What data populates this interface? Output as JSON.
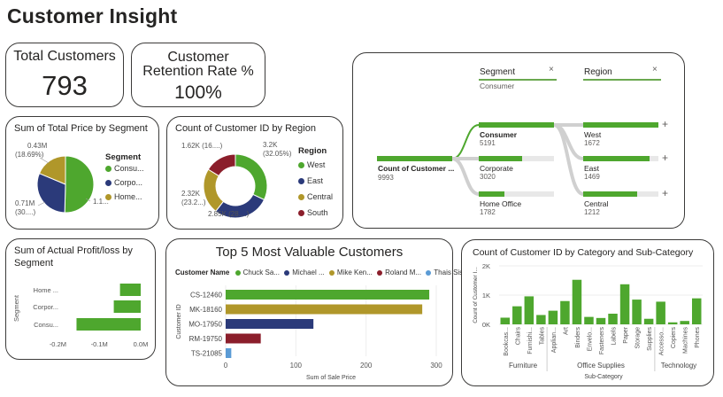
{
  "page_title": "Customer Insight",
  "colors": {
    "green": "#4ea72e",
    "navy": "#2b3a7a",
    "gold": "#b0972a",
    "maroon": "#8b1e2b",
    "blue": "#5b9bd5"
  },
  "kpi_total": {
    "label": "Total Customers",
    "value": "793"
  },
  "kpi_retention": {
    "label_line1": "Customer",
    "label_line2": "Retention Rate %",
    "value": "100%"
  },
  "segment_pie": {
    "title": "Sum of Total Price by Segment",
    "legend_title": "Segment",
    "legend": [
      "Consu...",
      "Corpo...",
      "Home..."
    ],
    "labels": {
      "home": "0.43M",
      "home_pct": "(18.69%)",
      "corp": "0.71M",
      "corp_pct": "(30....)",
      "cons": "1.1..."
    }
  },
  "region_donut": {
    "title": "Count of Customer ID by Region",
    "legend_title": "Region",
    "legend": [
      "West",
      "East",
      "Central",
      "South"
    ],
    "labels": {
      "west": "3.2K",
      "west_pct": "(32.05%)",
      "east": "2.85K (28....)",
      "central": "2.32K",
      "central_pct": "(23.2...)",
      "south": "1.62K (16....)"
    }
  },
  "decomp_tree": {
    "col1_header": "Segment",
    "col1_filter": "Consumer",
    "col2_header": "Region",
    "close_icon": "×",
    "root": {
      "label": "Count of Customer ...",
      "value": "9993"
    },
    "segments": [
      {
        "label": "Consumer",
        "value": "5191",
        "fraction": 1.0
      },
      {
        "label": "Corporate",
        "value": "3020",
        "fraction": 0.58
      },
      {
        "label": "Home Office",
        "value": "1782",
        "fraction": 0.34
      }
    ],
    "regions": [
      {
        "label": "West",
        "value": "1672",
        "fraction": 1.0
      },
      {
        "label": "East",
        "value": "1469",
        "fraction": 0.88
      },
      {
        "label": "Central",
        "value": "1212",
        "fraction": 0.72
      }
    ],
    "plus": "+"
  },
  "profit_chart": {
    "title_line1": "Sum of Actual Profit/loss by",
    "title_line2": "Segment",
    "ylabel": "Segment",
    "categories": [
      "Home ...",
      "Corpor...",
      "Consu..."
    ],
    "ticks": [
      "-0.2M",
      "-0.1M",
      "0.0M"
    ]
  },
  "top5": {
    "title": "Top 5 Most Valuable Customers",
    "legend_title": "Customer Name",
    "legend": [
      "Chuck Sa...",
      "Michael ...",
      "Mike Ken...",
      "Roland M...",
      "Thais Siss..."
    ],
    "ylabel": "Customer ID",
    "xlabel": "Sum of Sale Price",
    "ticks": [
      "0",
      "100",
      "200",
      "300"
    ]
  },
  "category_chart": {
    "title": "Count of Customer ID by Category and Sub-Category",
    "ylabel": "Count of Customer I...",
    "xlabel": "Sub-Category",
    "yticks": [
      "2K",
      "1K",
      "0K"
    ],
    "groups": [
      "Furniture",
      "Office Supplies",
      "Technology"
    ]
  },
  "chart_data": [
    {
      "type": "pie",
      "title": "Sum of Total Price by Segment",
      "categories": [
        "Consumer",
        "Corporate",
        "Home Office"
      ],
      "values": [
        1.16,
        0.71,
        0.43
      ],
      "unit": "M"
    },
    {
      "type": "pie",
      "title": "Count of Customer ID by Region",
      "donut": true,
      "categories": [
        "West",
        "East",
        "Central",
        "South"
      ],
      "values": [
        3.2,
        2.85,
        2.32,
        1.62
      ],
      "unit": "K"
    },
    {
      "type": "bar",
      "orientation": "horizontal",
      "title": "Sum of Actual Profit/loss by Segment",
      "categories": [
        "Home ...",
        "Corpor...",
        "Consu..."
      ],
      "values": [
        -0.05,
        -0.065,
        -0.155
      ],
      "xlim": [
        -0.25,
        0.0
      ],
      "unit": "M"
    },
    {
      "type": "bar",
      "orientation": "horizontal",
      "title": "Top 5 Most Valuable Customers",
      "categories": [
        "CS-12460",
        "MK-18160",
        "MO-17950",
        "RM-19750",
        "TS-21085"
      ],
      "values": [
        290,
        280,
        125,
        50,
        8
      ],
      "xlim": [
        0,
        300
      ]
    },
    {
      "type": "bar",
      "title": "Count of Customer ID by Category and Sub-Category",
      "categories": [
        "Bookcas...",
        "Chairs",
        "Furnishi...",
        "Tables",
        "Applian...",
        "Art",
        "Binders",
        "Envelo...",
        "Fasteners",
        "Labels",
        "Paper",
        "Storage",
        "Supplies",
        "Accesso...",
        "Copiers",
        "Machines",
        "Phones"
      ],
      "groups": [
        {
          "name": "Furniture",
          "count": 4
        },
        {
          "name": "Office Supplies",
          "count": 9
        },
        {
          "name": "Technology",
          "count": 4
        }
      ],
      "values": [
        228,
        617,
        957,
        319,
        466,
        796,
        1523,
        254,
        217,
        364,
        1370,
        846,
        190,
        775,
        68,
        115,
        889
      ],
      "ylim": [
        0,
        2000
      ]
    }
  ]
}
